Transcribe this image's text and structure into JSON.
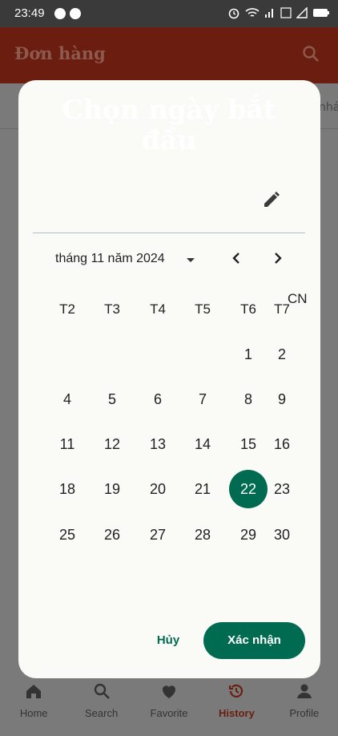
{
  "status_bar": {
    "time": "23:49"
  },
  "app_bar": {
    "title": "Đơn hàng"
  },
  "underlay": {
    "tab_partial": "nháp"
  },
  "dialog": {
    "title": "Chọn ngày bắt đầu",
    "month_label": "tháng 11 năm 2024",
    "weekdays": [
      "T2",
      "T3",
      "T4",
      "T5",
      "T6",
      "T7",
      "CN"
    ],
    "days": [
      "1",
      "2",
      "4",
      "5",
      "6",
      "7",
      "8",
      "9",
      "11",
      "12",
      "13",
      "14",
      "15",
      "16",
      "18",
      "19",
      "20",
      "21",
      "22",
      "23",
      "25",
      "26",
      "27",
      "28",
      "29",
      "30"
    ],
    "selected_day": "22",
    "cancel_label": "Hủy",
    "confirm_label": "Xác nhận"
  },
  "bottom_nav": {
    "items": [
      {
        "label": "Home",
        "icon": "home-icon"
      },
      {
        "label": "Search",
        "icon": "search-icon"
      },
      {
        "label": "Favorite",
        "icon": "heart-icon"
      },
      {
        "label": "History",
        "icon": "history-icon"
      },
      {
        "label": "Profile",
        "icon": "person-icon"
      }
    ],
    "active": "History"
  },
  "colors": {
    "accent": "#006b50",
    "app_bar": "#6b1e10",
    "dialog_bg": "#fafbf7"
  }
}
